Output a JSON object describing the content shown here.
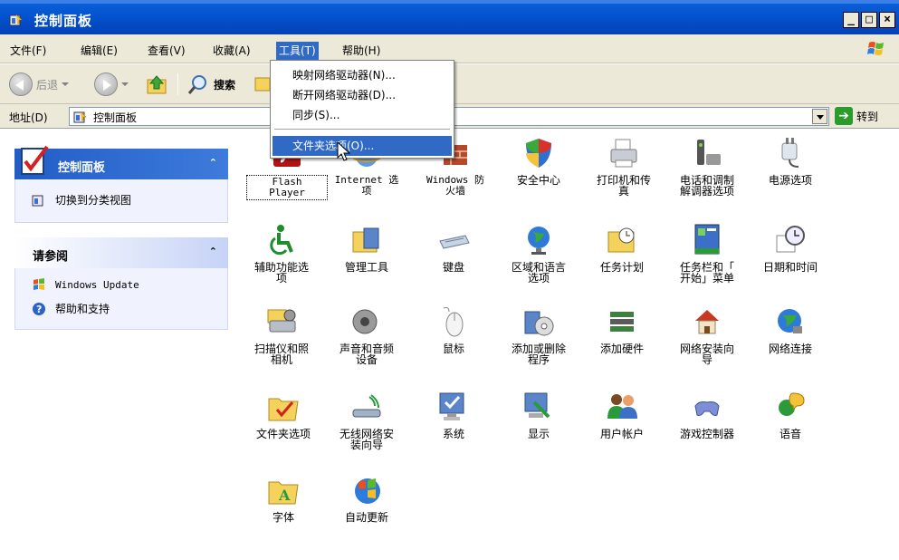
{
  "window": {
    "title": "控制面板"
  },
  "menubar": {
    "items": [
      "文件(F)",
      "编辑(E)",
      "查看(V)",
      "收藏(A)",
      "工具(T)",
      "帮助(H)"
    ],
    "active": "工具(T)"
  },
  "toolbar": {
    "back": "后退",
    "search": "搜索"
  },
  "address": {
    "label": "地址(D)",
    "value": "控制面板",
    "go": "转到"
  },
  "tools_menu": {
    "items": [
      "映射网络驱动器(N)...",
      "断开网络驱动器(D)...",
      "同步(S)...",
      "文件夹选项(O)..."
    ],
    "highlighted": "文件夹选项(O)..."
  },
  "left_pane": {
    "control_panel": {
      "title": "控制面板",
      "task": "切换到分类视图"
    },
    "see_also": {
      "title": "请参阅",
      "links": [
        "Windows Update",
        "帮助和支持"
      ]
    }
  },
  "items": [
    {
      "label": "Flash\nPlayer",
      "icon": "flash-icon"
    },
    {
      "label": "Internet 选\n项",
      "icon": "internet-options-icon"
    },
    {
      "label": "Windows 防\n火墙",
      "icon": "firewall-icon"
    },
    {
      "label": "安全中心",
      "icon": "security-center-icon"
    },
    {
      "label": "打印机和传\n真",
      "icon": "printer-icon"
    },
    {
      "label": "电话和调制\n解调器选项",
      "icon": "phone-modem-icon"
    },
    {
      "label": "电源选项",
      "icon": "power-icon"
    },
    {
      "label": "辅助功能选\n项",
      "icon": "accessibility-icon"
    },
    {
      "label": "管理工具",
      "icon": "admin-tools-icon"
    },
    {
      "label": "键盘",
      "icon": "keyboard-icon"
    },
    {
      "label": "区域和语言\n选项",
      "icon": "globe-icon"
    },
    {
      "label": "任务计划",
      "icon": "scheduled-tasks-icon"
    },
    {
      "label": "任务栏和「\n开始」菜单",
      "icon": "taskbar-icon"
    },
    {
      "label": "日期和时间",
      "icon": "clock-icon"
    },
    {
      "label": "扫描仪和照\n相机",
      "icon": "scanner-icon"
    },
    {
      "label": "声音和音频\n设备",
      "icon": "speaker-icon"
    },
    {
      "label": "鼠标",
      "icon": "mouse-icon"
    },
    {
      "label": "添加或删除\n程序",
      "icon": "add-remove-icon"
    },
    {
      "label": "添加硬件",
      "icon": "hardware-icon"
    },
    {
      "label": "网络安装向\n导",
      "icon": "network-wizard-icon"
    },
    {
      "label": "网络连接",
      "icon": "network-icon"
    },
    {
      "label": "文件夹选项",
      "icon": "folder-options-icon"
    },
    {
      "label": "无线网络安\n装向导",
      "icon": "wireless-icon"
    },
    {
      "label": "系统",
      "icon": "system-icon"
    },
    {
      "label": "显示",
      "icon": "display-icon"
    },
    {
      "label": "用户帐户",
      "icon": "users-icon"
    },
    {
      "label": "游戏控制器",
      "icon": "gamepad-icon"
    },
    {
      "label": "语音",
      "icon": "speech-icon"
    },
    {
      "label": "字体",
      "icon": "fonts-icon"
    },
    {
      "label": "自动更新",
      "icon": "windows-update-icon"
    }
  ]
}
